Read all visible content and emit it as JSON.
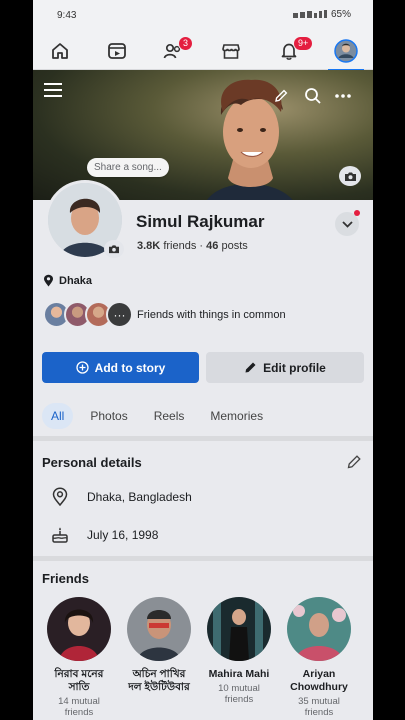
{
  "status_bar": {
    "time": "9:43",
    "battery": "65%"
  },
  "nav": {
    "friends_badge": "3",
    "notifications_badge": "9+"
  },
  "cover": {
    "song_prompt": "Share a song..."
  },
  "profile": {
    "name": "Simul Rajkumar",
    "friends_count": "3.8K",
    "friends_label": "friends",
    "separator": "·",
    "posts_count": "46",
    "posts_label": "posts",
    "location": "Dhaka",
    "common_text": "Friends with things in common"
  },
  "buttons": {
    "add_story": "Add to story",
    "edit_profile": "Edit profile"
  },
  "tabs": [
    "All",
    "Photos",
    "Reels",
    "Memories"
  ],
  "personal_details": {
    "title": "Personal details",
    "items": [
      {
        "icon": "location-pin-icon",
        "text": "Dhaka, Bangladesh"
      },
      {
        "icon": "birthday-cake-icon",
        "text": "July 16, 1998"
      }
    ]
  },
  "friends": {
    "title": "Friends",
    "list": [
      {
        "name": "নিরাব মনের সাতি",
        "mutual": "14 mutual friends"
      },
      {
        "name": "অচিন পাখির দল ইউটিউবার",
        "mutual": ""
      },
      {
        "name": "Mahira Mahi",
        "mutual": "10 mutual friends"
      },
      {
        "name": "Ariyan Chowdhury",
        "mutual": "35 mutual friends"
      }
    ]
  },
  "colors": {
    "accent": "#1b63c9",
    "badge": "#e41e3f"
  }
}
